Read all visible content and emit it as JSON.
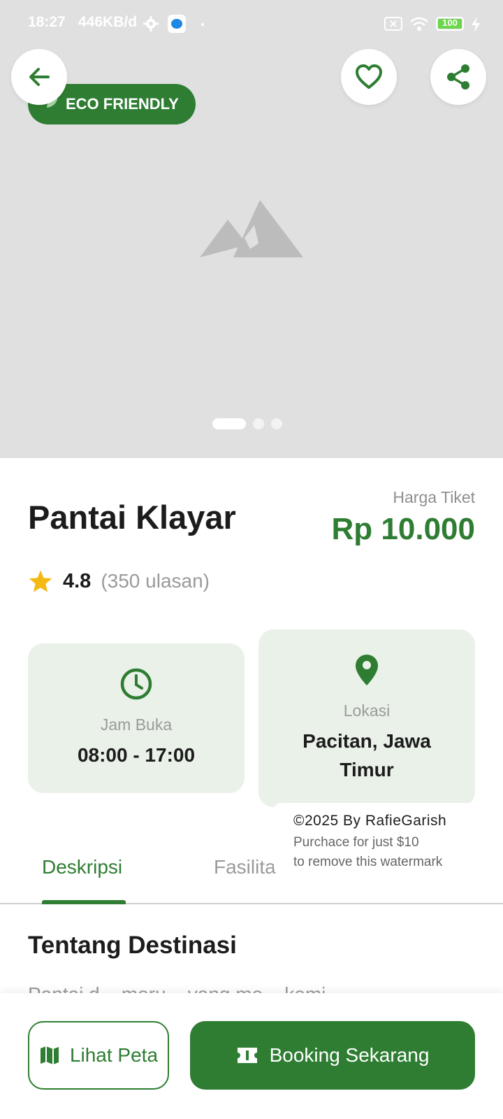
{
  "status_bar": {
    "time": "18:27",
    "speed": "446KB/d",
    "battery": "100"
  },
  "hero": {
    "badge_label": "ECO FRIENDLY"
  },
  "destination": {
    "name": "Pantai Klayar",
    "price_label": "Harga Tiket",
    "price": "Rp 10.000",
    "rating": "4.8",
    "review_count": "(350 ulasan)"
  },
  "info_cards": {
    "hours": {
      "label": "Jam Buka",
      "value": "08:00 - 17:00"
    },
    "location": {
      "label": "Lokasi",
      "value": "Pacitan, Jawa Timur"
    }
  },
  "watermark": {
    "line1": "©2025 By RafieGarish",
    "line2": "Purchace for just $10",
    "line3": "to remove this watermark"
  },
  "tabs": [
    {
      "label": "Deskripsi",
      "active": true
    },
    {
      "label": "Fasilita",
      "active": false
    }
  ],
  "about": {
    "title": "Tentang Destinasi",
    "peek": "Pantai d... meru... yang me... kemi..."
  },
  "actions": {
    "map_label": "Lihat Peta",
    "book_label": "Booking Sekarang"
  },
  "colors": {
    "primary": "#2e7d32",
    "star": "#f5b916",
    "card_bg": "#e9f1e8",
    "hero_bg": "#e0e0e0"
  }
}
